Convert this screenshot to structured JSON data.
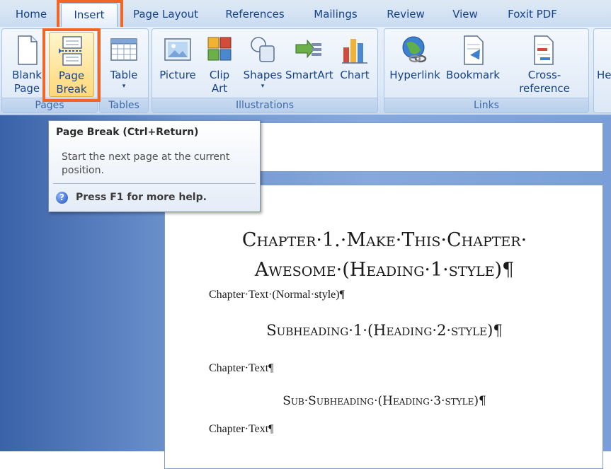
{
  "tabs": [
    "Home",
    "Insert",
    "Page Layout",
    "References",
    "Mailings",
    "Review",
    "View",
    "Foxit PDF"
  ],
  "active_tab": "Insert",
  "highlight_color": "#f26522",
  "groups": {
    "pages": {
      "label": "Pages",
      "blank_page": [
        "Blank",
        "Page"
      ],
      "page_break": [
        "Page",
        "Break"
      ]
    },
    "tables": {
      "label": "Tables",
      "table": "Table",
      "caret": "▾"
    },
    "illustrations": {
      "label": "Illustrations",
      "picture": "Picture",
      "clip_art": [
        "Clip",
        "Art"
      ],
      "shapes": "Shapes",
      "shapes_caret": "▾",
      "smartart": "SmartArt",
      "chart": "Chart"
    },
    "links": {
      "label": "Links",
      "hyperlink": "Hyperlink",
      "bookmark": "Bookmark",
      "cross_reference": "Cross-reference"
    },
    "next_partial": "He"
  },
  "tooltip": {
    "title": "Page Break (Ctrl+Return)",
    "description": "Start the next page at the current position.",
    "help_icon": "?",
    "help": "Press F1 for more help."
  },
  "document": {
    "heading1_line1": "Chapter·1.·Make·This·Chapter·",
    "heading1_line2": "Awesome·(Heading·1·style)¶",
    "para1": "Chapter·Text·(Normal·style)¶",
    "heading2": "Subheading·1·(Heading·2·style)¶",
    "para2": "Chapter·Text¶",
    "heading3": "Sub·Subheading·(Heading·3·style)¶",
    "para3": "Chapter·Text¶"
  }
}
